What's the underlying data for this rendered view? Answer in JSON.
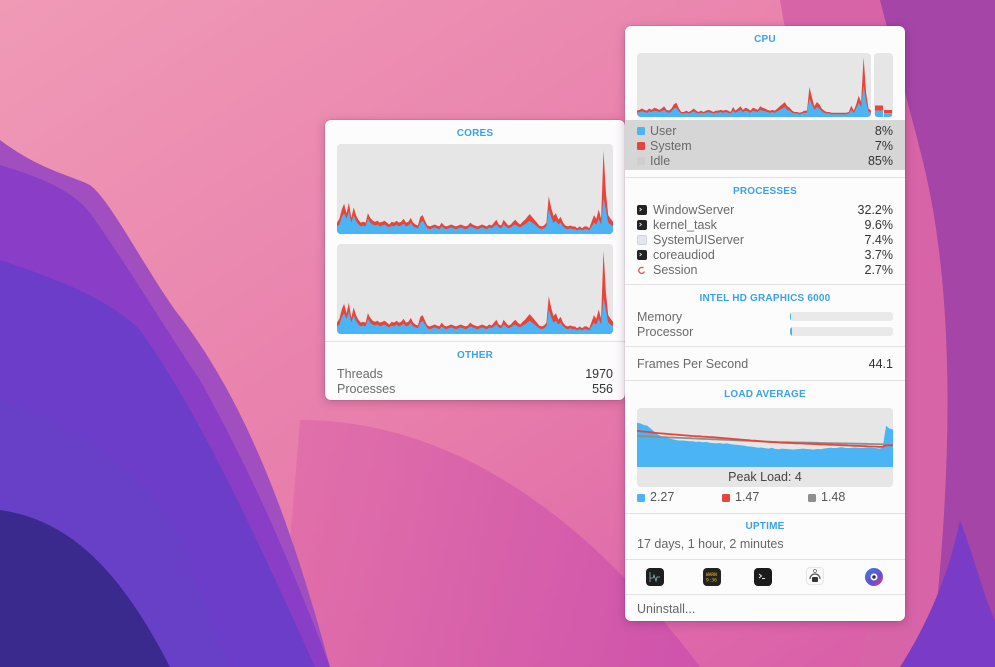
{
  "colors": {
    "accent": "#3aa2e8",
    "user": "#4ab4f5",
    "system": "#e8443a",
    "idle": "#d6d6d6",
    "load_1": "#4ab4f5",
    "load_5": "#e8443a",
    "load_15": "#8e8e8e"
  },
  "cores": {
    "title": "CORES",
    "graphs": [
      {
        "name": "core-1",
        "user": [
          8,
          10,
          18,
          22,
          16,
          24,
          12,
          20,
          14,
          10,
          8,
          9,
          8,
          16,
          12,
          10,
          9,
          10,
          8,
          9,
          10,
          8,
          7,
          9,
          8,
          10,
          8,
          9,
          11,
          8,
          9,
          12,
          8,
          7,
          6,
          12,
          14,
          10,
          6,
          5,
          6,
          7,
          6,
          5,
          8,
          6,
          5,
          6,
          7,
          6,
          5,
          6,
          7,
          6,
          5,
          6,
          8,
          7,
          6,
          5,
          6,
          7,
          6,
          5,
          7,
          6,
          8,
          10,
          7,
          6,
          10,
          8,
          6,
          7,
          9,
          10,
          8,
          7,
          9,
          10,
          12,
          14,
          12,
          10,
          8,
          6,
          5,
          6,
          8,
          26,
          18,
          12,
          14,
          10,
          12,
          8,
          6,
          5,
          6,
          5,
          5,
          4,
          5,
          4,
          5,
          5,
          4,
          8,
          12,
          10,
          16,
          10,
          38,
          26,
          12,
          10,
          8
        ],
        "system": [
          4,
          6,
          8,
          10,
          6,
          9,
          5,
          8,
          6,
          5,
          4,
          4,
          4,
          6,
          5,
          4,
          4,
          4,
          4,
          4,
          4,
          4,
          3,
          4,
          4,
          4,
          4,
          4,
          5,
          4,
          4,
          5,
          4,
          3,
          3,
          6,
          6,
          4,
          3,
          3,
          3,
          3,
          3,
          3,
          4,
          3,
          3,
          3,
          3,
          3,
          3,
          3,
          3,
          3,
          3,
          3,
          4,
          3,
          3,
          3,
          3,
          3,
          3,
          3,
          3,
          3,
          4,
          5,
          3,
          3,
          5,
          4,
          3,
          3,
          4,
          5,
          4,
          3,
          4,
          5,
          6,
          7,
          6,
          5,
          4,
          3,
          3,
          3,
          4,
          14,
          10,
          7,
          8,
          5,
          6,
          4,
          3,
          3,
          3,
          3,
          3,
          2,
          3,
          2,
          3,
          3,
          2,
          5,
          8,
          6,
          10,
          6,
          50,
          18,
          8,
          6,
          5
        ]
      },
      {
        "name": "core-2",
        "user": [
          8,
          10,
          18,
          22,
          16,
          24,
          12,
          20,
          14,
          10,
          8,
          9,
          8,
          16,
          12,
          10,
          9,
          10,
          8,
          9,
          10,
          8,
          7,
          9,
          8,
          10,
          8,
          9,
          11,
          8,
          9,
          12,
          8,
          7,
          6,
          12,
          14,
          10,
          6,
          5,
          6,
          7,
          6,
          5,
          8,
          6,
          5,
          6,
          7,
          6,
          5,
          6,
          7,
          6,
          5,
          6,
          8,
          7,
          6,
          5,
          6,
          7,
          6,
          5,
          7,
          6,
          8,
          10,
          7,
          6,
          10,
          8,
          6,
          7,
          9,
          10,
          8,
          7,
          9,
          10,
          12,
          14,
          12,
          10,
          8,
          6,
          5,
          6,
          8,
          26,
          18,
          12,
          14,
          10,
          12,
          8,
          6,
          5,
          6,
          5,
          5,
          4,
          5,
          4,
          5,
          5,
          4,
          8,
          12,
          10,
          16,
          10,
          38,
          26,
          12,
          10,
          8
        ],
        "system": [
          4,
          6,
          8,
          10,
          6,
          9,
          5,
          8,
          6,
          5,
          4,
          4,
          4,
          6,
          5,
          4,
          4,
          4,
          4,
          4,
          4,
          4,
          3,
          4,
          4,
          4,
          4,
          4,
          5,
          4,
          4,
          5,
          4,
          3,
          3,
          6,
          6,
          4,
          3,
          3,
          3,
          3,
          3,
          3,
          4,
          3,
          3,
          3,
          3,
          3,
          3,
          3,
          3,
          3,
          3,
          3,
          4,
          3,
          3,
          3,
          3,
          3,
          3,
          3,
          3,
          3,
          4,
          5,
          3,
          3,
          5,
          4,
          3,
          3,
          4,
          5,
          4,
          3,
          4,
          5,
          6,
          7,
          6,
          5,
          4,
          3,
          3,
          3,
          4,
          14,
          10,
          7,
          8,
          5,
          6,
          4,
          3,
          3,
          3,
          3,
          3,
          2,
          3,
          2,
          3,
          3,
          2,
          5,
          8,
          6,
          10,
          6,
          50,
          18,
          8,
          6,
          5
        ]
      }
    ]
  },
  "other": {
    "title": "OTHER",
    "rows": [
      {
        "label": "Threads",
        "value": "1970"
      },
      {
        "label": "Processes",
        "value": "556"
      }
    ]
  },
  "cpu": {
    "title": "CPU",
    "history": {
      "user": [
        6,
        7,
        8,
        7,
        6,
        8,
        7,
        9,
        8,
        7,
        8,
        10,
        7,
        6,
        8,
        12,
        13,
        8,
        5,
        5,
        6,
        5,
        6,
        8,
        6,
        5,
        6,
        5,
        6,
        7,
        6,
        5,
        6,
        6,
        7,
        6,
        7,
        6,
        5,
        9,
        6,
        8,
        10,
        7,
        9,
        8,
        6,
        9,
        8,
        7,
        10,
        9,
        8,
        7,
        6,
        7,
        6,
        8,
        10,
        12,
        14,
        10,
        9,
        6,
        5,
        5,
        4,
        5,
        6,
        6,
        26,
        18,
        10,
        14,
        12,
        8,
        6,
        5,
        5,
        4,
        4,
        4,
        4,
        4,
        4,
        4,
        5,
        10,
        6,
        12,
        20,
        14,
        44,
        22,
        8,
        6
      ],
      "system": [
        3,
        3,
        4,
        3,
        3,
        4,
        3,
        4,
        4,
        3,
        4,
        5,
        3,
        3,
        4,
        6,
        7,
        4,
        2,
        2,
        3,
        2,
        3,
        4,
        3,
        2,
        3,
        2,
        3,
        3,
        3,
        2,
        3,
        3,
        3,
        3,
        3,
        3,
        2,
        5,
        3,
        4,
        5,
        3,
        4,
        4,
        3,
        4,
        4,
        3,
        5,
        4,
        4,
        3,
        3,
        3,
        3,
        4,
        5,
        6,
        7,
        5,
        4,
        3,
        2,
        2,
        2,
        2,
        3,
        3,
        16,
        10,
        5,
        7,
        6,
        4,
        3,
        2,
        2,
        2,
        2,
        2,
        2,
        2,
        2,
        2,
        2,
        6,
        3,
        6,
        10,
        7,
        40,
        12,
        4,
        3
      ]
    },
    "current": {
      "user": 8,
      "system": 7
    },
    "rows": [
      {
        "label": "User",
        "value": "8%",
        "swatch": "#4ab4f5"
      },
      {
        "label": "System",
        "value": "7%",
        "swatch": "#e8443a"
      },
      {
        "label": "Idle",
        "value": "85%",
        "swatch": "#d6d6d6"
      }
    ]
  },
  "processes": {
    "title": "PROCESSES",
    "items": [
      {
        "name": "WindowServer",
        "value": "32.2%",
        "icon": "terminal-exec-icon"
      },
      {
        "name": "kernel_task",
        "value": "9.6%",
        "icon": "terminal-exec-icon"
      },
      {
        "name": "SystemUIServer",
        "value": "7.4%",
        "icon": "generic-app-icon"
      },
      {
        "name": "coreaudiod",
        "value": "3.7%",
        "icon": "terminal-exec-icon"
      },
      {
        "name": "Session",
        "value": "2.7%",
        "icon": "session-icon"
      }
    ]
  },
  "gpu": {
    "title": "INTEL HD GRAPHICS 6000",
    "rows": [
      {
        "label": "Memory",
        "percent": 1
      },
      {
        "label": "Processor",
        "percent": 2
      }
    ],
    "fps_label": "Frames Per Second",
    "fps_value": "44.1"
  },
  "load": {
    "title": "LOAD AVERAGE",
    "peak_label": "Peak Load: 4",
    "max": 4,
    "series": {
      "one": [
        3.0,
        2.95,
        2.85,
        2.8,
        2.6,
        2.4,
        2.2,
        2.1,
        2.0,
        1.95,
        1.9,
        1.85,
        1.8,
        1.8,
        1.78,
        1.75,
        1.75,
        1.7,
        1.72,
        1.68,
        1.7,
        1.65,
        1.62,
        1.6,
        1.62,
        1.58,
        1.6,
        1.55,
        1.52,
        1.5,
        1.48,
        1.45,
        1.4,
        1.38,
        1.35,
        1.3,
        1.32,
        1.28,
        1.25,
        1.3,
        1.22,
        1.2,
        1.25,
        1.22,
        1.2,
        1.18,
        1.2,
        1.22,
        1.25,
        1.22,
        1.2,
        1.18,
        1.22,
        1.2,
        1.25,
        1.28,
        1.3,
        1.28,
        1.3,
        1.35,
        1.3,
        1.28,
        1.3,
        1.32,
        1.3,
        1.28,
        1.3,
        1.32,
        1.3,
        1.28,
        1.25,
        1.3,
        2.8,
        2.6,
        2.55
      ],
      "five": [
        2.45,
        2.42,
        2.4,
        2.38,
        2.35,
        2.32,
        2.3,
        2.28,
        2.26,
        2.24,
        2.22,
        2.2,
        2.18,
        2.16,
        2.14,
        2.12,
        2.1,
        2.09,
        2.08,
        2.06,
        2.05,
        2.03,
        2.02,
        2.0,
        1.98,
        1.96,
        1.94,
        1.92,
        1.9,
        1.88,
        1.86,
        1.84,
        1.82,
        1.8,
        1.78,
        1.76,
        1.74,
        1.72,
        1.7,
        1.69,
        1.68,
        1.66,
        1.65,
        1.64,
        1.63,
        1.62,
        1.61,
        1.6,
        1.59,
        1.58,
        1.57,
        1.56,
        1.55,
        1.54,
        1.53,
        1.52,
        1.51,
        1.5,
        1.49,
        1.48,
        1.47,
        1.46,
        1.45,
        1.44,
        1.43,
        1.42,
        1.41,
        1.4,
        1.39,
        1.38,
        1.37,
        1.36,
        1.47,
        1.47,
        1.47
      ],
      "fifteen": [
        2.1,
        2.09,
        2.08,
        2.07,
        2.06,
        2.05,
        2.04,
        2.03,
        2.02,
        2.01,
        2.0,
        1.99,
        1.98,
        1.97,
        1.96,
        1.95,
        1.94,
        1.93,
        1.92,
        1.91,
        1.9,
        1.89,
        1.88,
        1.87,
        1.86,
        1.85,
        1.84,
        1.83,
        1.82,
        1.81,
        1.8,
        1.79,
        1.78,
        1.77,
        1.76,
        1.75,
        1.74,
        1.73,
        1.72,
        1.71,
        1.7,
        1.69,
        1.69,
        1.68,
        1.68,
        1.67,
        1.67,
        1.66,
        1.66,
        1.65,
        1.65,
        1.64,
        1.64,
        1.63,
        1.63,
        1.62,
        1.62,
        1.61,
        1.61,
        1.6,
        1.6,
        1.59,
        1.59,
        1.58,
        1.58,
        1.57,
        1.57,
        1.56,
        1.56,
        1.55,
        1.55,
        1.54,
        1.48,
        1.48,
        1.48
      ]
    },
    "legend": [
      {
        "value": "2.27",
        "color": "#4ab4f5"
      },
      {
        "value": "1.47",
        "color": "#e8443a"
      },
      {
        "value": "1.48",
        "color": "#8e8e8e"
      }
    ]
  },
  "uptime": {
    "title": "UPTIME",
    "value": "17 days, 1 hour, 2 minutes"
  },
  "apps": [
    {
      "name": "activity-monitor-icon"
    },
    {
      "name": "console-icon"
    },
    {
      "name": "terminal-icon"
    },
    {
      "name": "system-information-icon"
    },
    {
      "name": "istat-menus-icon"
    }
  ],
  "footer": {
    "uninstall_label": "Uninstall..."
  }
}
